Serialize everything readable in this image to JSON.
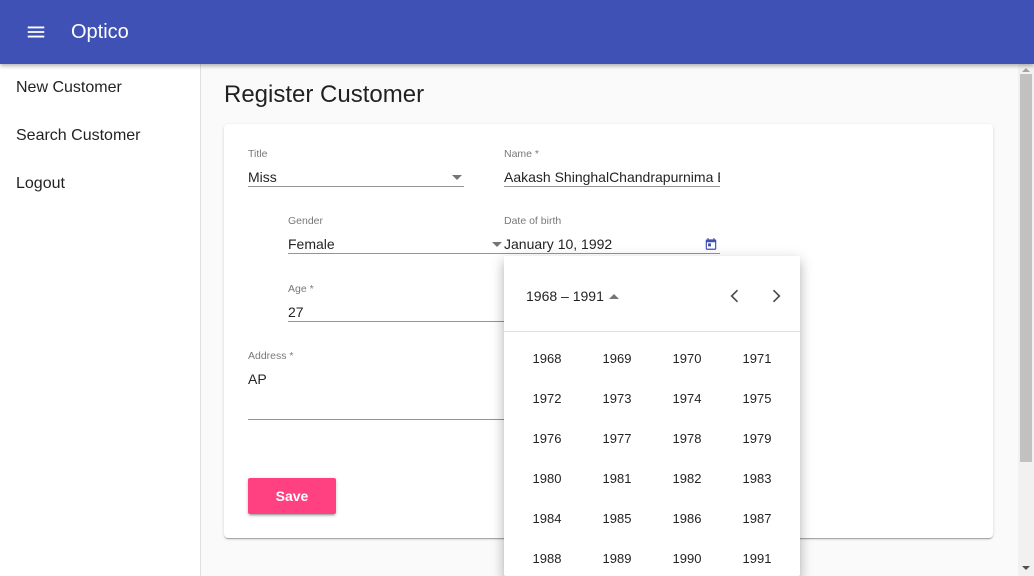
{
  "app": {
    "title": "Optico",
    "menu_icon": "menu-icon",
    "accent": "#3f51b5"
  },
  "sidebar": {
    "items": [
      {
        "label": "New Customer"
      },
      {
        "label": "Search Customer"
      },
      {
        "label": "Logout"
      }
    ]
  },
  "page": {
    "title": "Register Customer"
  },
  "form": {
    "title_field": {
      "label": "Title",
      "value": "Miss"
    },
    "name_field": {
      "label": "Name *",
      "value": "Aakash ShinghalChandrapurnima Bo"
    },
    "gender_field": {
      "label": "Gender",
      "value": "Female"
    },
    "dob_field": {
      "label": "Date of birth",
      "value": "January 10, 1992",
      "icon": "calendar-icon"
    },
    "age_field": {
      "label": "Age *",
      "value": "27"
    },
    "address_field": {
      "label": "Address *",
      "value": "AP"
    },
    "save_label": "Save",
    "save_color": "#ff4081"
  },
  "datepicker": {
    "period_label": "1968 – 1991",
    "prev_icon": "chevron-left-icon",
    "next_icon": "chevron-right-icon",
    "years": [
      "1968",
      "1969",
      "1970",
      "1971",
      "1972",
      "1973",
      "1974",
      "1975",
      "1976",
      "1977",
      "1978",
      "1979",
      "1980",
      "1981",
      "1982",
      "1983",
      "1984",
      "1985",
      "1986",
      "1987",
      "1988",
      "1989",
      "1990",
      "1991"
    ]
  }
}
